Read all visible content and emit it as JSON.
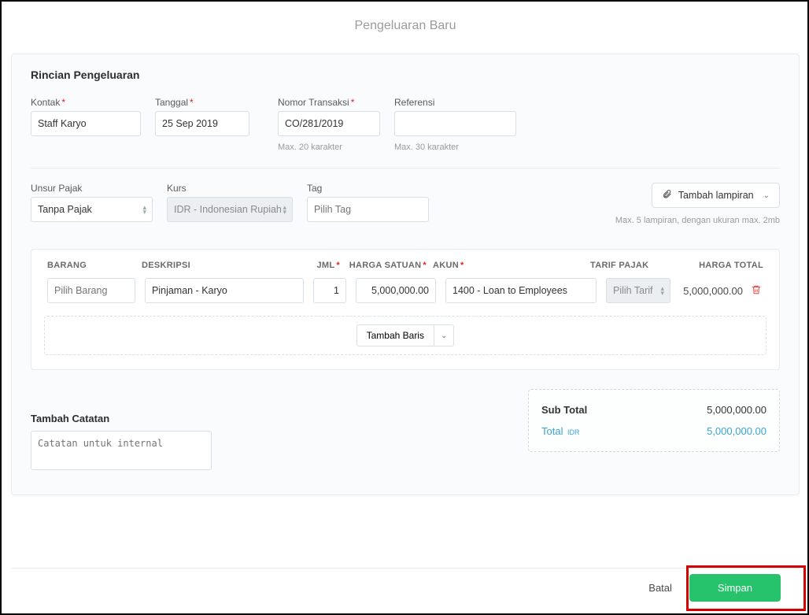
{
  "header": {
    "title": "Pengeluaran Baru"
  },
  "section": {
    "title": "Rincian Pengeluaran"
  },
  "fields": {
    "kontak": {
      "label": "Kontak",
      "value": "Staff Karyo"
    },
    "tanggal": {
      "label": "Tanggal",
      "value": "25 Sep 2019"
    },
    "nomor": {
      "label": "Nomor Transaksi",
      "value": "CO/281/2019",
      "hint": "Max. 20 karakter"
    },
    "referensi": {
      "label": "Referensi",
      "value": "",
      "hint": "Max. 30 karakter"
    },
    "unsur": {
      "label": "Unsur Pajak",
      "value": "Tanpa Pajak"
    },
    "kurs": {
      "label": "Kurs",
      "value": "IDR - Indonesian Rupiah"
    },
    "tag": {
      "label": "Tag",
      "placeholder": "Pilih Tag"
    }
  },
  "attachments": {
    "button": "Tambah lampiran",
    "hint": "Max. 5 lampiran, dengan ukuran max. 2mb"
  },
  "table": {
    "headers": {
      "barang": "BARANG",
      "deskripsi": "DESKRIPSI",
      "jml": "JML",
      "harga": "HARGA SATUAN",
      "akun": "AKUN",
      "tarif": "TARIF PAJAK",
      "total": "HARGA TOTAL"
    },
    "rows": [
      {
        "barang_placeholder": "Pilih Barang",
        "deskripsi": "Pinjaman - Karyo",
        "jml": "1",
        "harga": "5,000,000.00",
        "akun": "1400 - Loan to Employees",
        "tarif": "Pilih Tarif",
        "total": "5,000,000.00"
      }
    ],
    "add_row": "Tambah Baris"
  },
  "notes": {
    "title": "Tambah Catatan",
    "placeholder": "Catatan untuk internal"
  },
  "totals": {
    "subtotal_label": "Sub Total",
    "subtotal_value": "5,000,000.00",
    "total_label": "Total",
    "currency": " IDR",
    "total_value": "5,000,000.00"
  },
  "footer": {
    "cancel": "Batal",
    "save": "Simpan"
  }
}
